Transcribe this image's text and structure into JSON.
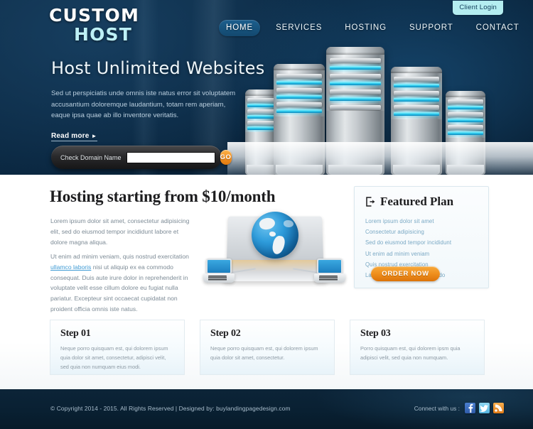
{
  "header": {
    "client_login": "Client Login",
    "logo_top": "CUSTOM",
    "logo_bottom": "HOST",
    "nav": [
      {
        "label": "HOME",
        "active": true
      },
      {
        "label": "SERVICES",
        "active": false
      },
      {
        "label": "HOSTING",
        "active": false
      },
      {
        "label": "SUPPORT",
        "active": false
      },
      {
        "label": "CONTACT",
        "active": false
      }
    ]
  },
  "hero": {
    "title": "Host Unlimited Websites",
    "text": "Sed ut perspiciatis unde omnis iste natus error sit voluptatem accusantium doloremque laudantium, totam rem aperiam, eaque ipsa quae ab illo inventore veritatis.",
    "read_more": "Read more",
    "read_more_icon": "play-triangle-icon"
  },
  "domain_search": {
    "label": "Check Domain Name",
    "value": "",
    "placeholder": "",
    "button": "GO"
  },
  "main": {
    "title": "Hosting starting from $10/month",
    "paragraph_1": "Lorem ipsum dolor sit amet, consectetur adipisicing elit, sed do eiusmod tempor incididunt  labore et dolore magna aliqua.",
    "paragraph_2_part1": "Ut enim ad minim veniam, quis nostrud exercitation ",
    "paragraph_2_link": "ullamco laboris",
    "paragraph_2_part2": " nisi ut aliquip ex ea commodo consequat. Duis aute irure dolor in reprehenderit in voluptate velit esse cillum dolore eu fugiat nulla pariatur. Excepteur sint occaecat cupidatat non proident officia omnis iste natus."
  },
  "featured": {
    "icon": "export-box-icon",
    "title": "Featured Plan",
    "items": [
      "Lorem ipsum dolor sit amet",
      "Consectetur adipisicing",
      "Sed do eiusmod tempor incididunt",
      "Ut enim ad minim veniam",
      "Quis nostrud exercitation",
      "Laboris nisi ut aliquip commodo"
    ],
    "order_button": "ORDER NOW"
  },
  "steps": [
    {
      "title": "Step 01",
      "text": "Neque porro quisquam est, qui dolorem ipsum quia dolor sit amet, consectetur, adipisci velit, sed quia non numquam eius modi."
    },
    {
      "title": "Step 02",
      "text": "Neque porro quisquam est, qui dolorem ipsum quia dolor sit amet, consectetur."
    },
    {
      "title": "Step 03",
      "text": "Porro quisquam est, qui dolorem ipsm quia adipisci velit, sed quia non numquam."
    }
  ],
  "footer": {
    "copyright": "© Copyright 2014 - 2015. All Rights Reserved | Designed by: buylandingpagedesign.com",
    "connect_label": "Connect with us :",
    "social": [
      {
        "name": "facebook-icon",
        "glyph": "f"
      },
      {
        "name": "twitter-icon",
        "glyph": "t"
      },
      {
        "name": "rss-icon",
        "glyph": "»"
      }
    ]
  },
  "colors": {
    "hero_dark": "#0b2943",
    "accent_orange": "#ef8f1d",
    "accent_cyan": "#b4edf0",
    "link_blue": "#3f9bd4",
    "footer_dark": "#092032"
  }
}
